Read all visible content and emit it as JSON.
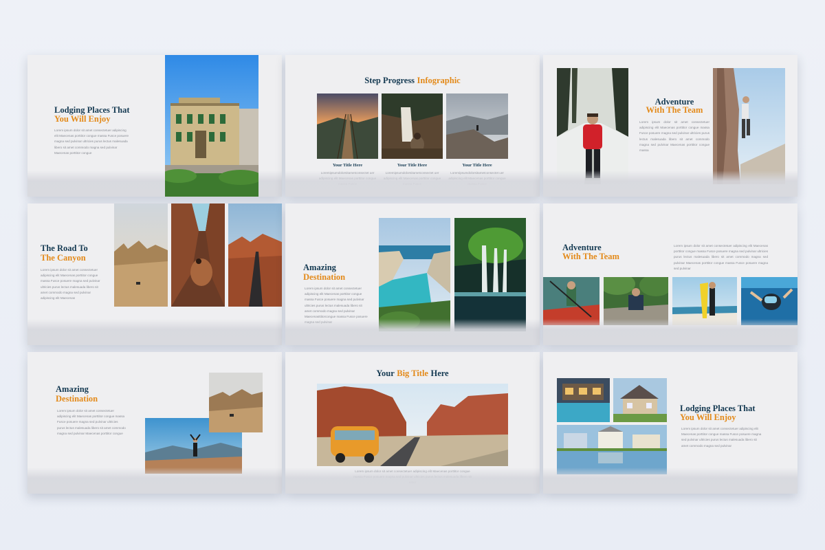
{
  "lorem_body": "Lorem ipsum dolor sit amet consectetuer adipiscing elit Maecenas porttitor congue massa Fusce posuere magna sed pulvinar ultricies purus lectus malesuada libero sit amet commodo magna",
  "slides": {
    "s1": {
      "title_a": "Lodging Places That",
      "title_b": "You Will Enjoy",
      "body": "Lorem ipsum dolor sit amet consectetuer adipiscing elit Maecenas porttitor congue massa Fusce posuere magna sed pulvinar ultricies purus lectus malesuada libero sit amet commodo magna sed pulvinar Maecenas porttitor congue"
    },
    "s2": {
      "title_a": "Step Progress",
      "title_b": "Infographic",
      "items": [
        {
          "title": "Your Title Here",
          "body": "Loremipsumdolorsitametconsectet uer adipiscing elit Maecenas porttitor congue massa Fusce"
        },
        {
          "title": "Your Title Here",
          "body": "Loremipsumdolorsitametconsectet uer adipiscing elit Maecenas porttitor congue massa Fusce"
        },
        {
          "title": "Your Title Here",
          "body": "Loremipsumdolorsitametconsectet uer adipiscing elit Maecenas porttitor congue massa Fusce"
        }
      ]
    },
    "s3": {
      "title_a": "Adventure",
      "title_b": "With The Team",
      "body": "Lorem ipsum dolor sit amet consectetuer adipiscing elit Maecenas porttitor congue massa Fusce posuere magna sed pulvinar ultricies purus lectus malesuada libero sit amet commodo magna sed pulvinar Maecenas porttitor congue massa"
    },
    "s4": {
      "title_a": "The Road To",
      "title_b": "The Canyon",
      "body": "Lorem ipsum dolor sit amet consectetuer adipiscing elit Maecenas porttitor congue massa Fusce posuere magna sed pulvinar ultricies purus lectus malesuada libero sit amet commodo magna sed pulvinar adipiscing elit Maecenas"
    },
    "s5": {
      "title_a": "Amazing",
      "title_b": "Destination",
      "body": "Lorem ipsum dolor sit amet consectetuer adipiscing elit Maecenas porttitor congue massa Fusce posuere magna sed pulvinar ultricies purus lectus malesuada libero sit amet commodo magna sed pulvinar Maecenasttitorcongue massa Fusce posuere magna sed pulvinar"
    },
    "s6": {
      "title_a": "Adventure",
      "title_b": "With The Team",
      "body": "Lorem ipsum dolor sit amet consectetuer adipiscing elit Maecenas porttitor congue massa Fusce posuere magna sed pulvinar ultricies purus lectus malesuada libero sit amet commodo magna sed pulvinar Maecenas porttitor congue massa Fusce posuere magna sed pulvinar"
    },
    "s7": {
      "title_a": "Amazing",
      "title_b": "Destination",
      "body": "Lorem ipsum dolor sit amet consectetuer adipiscing elit Maecenas porttitor congue massa Fusce posuere magna sed pulvinar ultricies purus lectus malesuada libero sit amet commodo magna sed pulvinar Maecenas porttitor congue"
    },
    "s8": {
      "title_a": "Your",
      "title_b": "Big Title",
      "title_c": "Here",
      "body": "Lorem ipsum dolor sit amet consectetuer adipiscing elit Maecenas porttitor congue massa Fusce posuere magna sed pulvinar ultricies purus lectus malesuada libero sit amet"
    },
    "s9": {
      "title_a": "Lodging Places That",
      "title_b": "You Will Enjoy",
      "body": "Lorem ipsum dolor sit amet consectetuer adipiscing elit Maecenas porttitor congue massa Fusce posuere magna sed pulvinar ultricies purus lectus malesuada libero sit amet commodo magna sed pulvinar"
    }
  }
}
